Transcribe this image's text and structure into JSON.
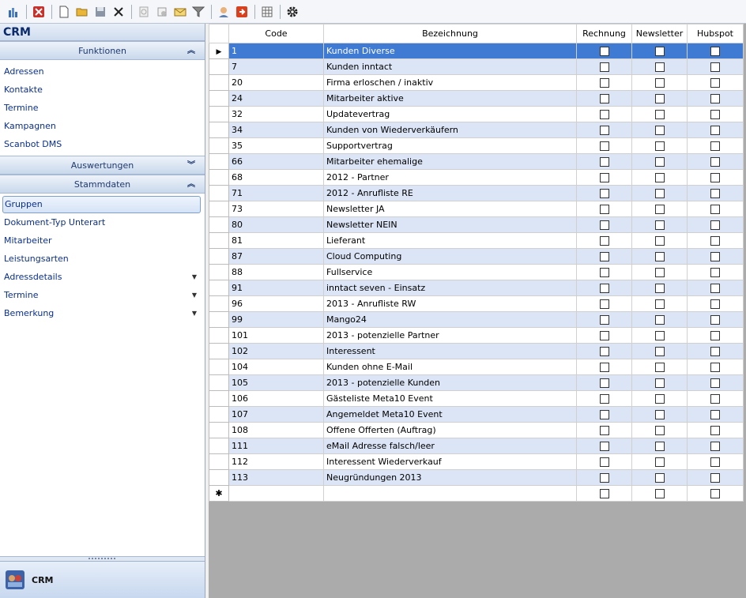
{
  "toolbar": {
    "icons": [
      "chart-icon",
      "delete-icon",
      "new-document-icon",
      "open-folder-icon",
      "save-icon",
      "close-icon",
      "copy-icon",
      "settings-doc-icon",
      "mail-icon",
      "filter-icon",
      "user-icon",
      "export-icon",
      "grid-icon",
      "gear-icon"
    ],
    "colors": {
      "delete": "#c8302c",
      "export": "#d9411e",
      "folder": "#e9b637"
    }
  },
  "sidebar": {
    "title": "CRM",
    "groups": [
      {
        "label": "Funktionen",
        "expanded": true,
        "items": [
          {
            "label": "Adressen"
          },
          {
            "label": "Kontakte"
          },
          {
            "label": "Termine"
          },
          {
            "label": "Kampagnen"
          },
          {
            "label": "Scanbot DMS"
          }
        ]
      },
      {
        "label": "Auswertungen",
        "expanded": false,
        "items": []
      },
      {
        "label": "Stammdaten",
        "expanded": true,
        "items": [
          {
            "label": "Gruppen",
            "selected": true
          },
          {
            "label": "Dokument-Typ Unterart"
          },
          {
            "label": "Mitarbeiter"
          },
          {
            "label": "Leistungsarten"
          },
          {
            "label": "Adressdetails",
            "dropdown": true
          },
          {
            "label": "Termine",
            "dropdown": true
          },
          {
            "label": "Bemerkung",
            "dropdown": true
          }
        ]
      }
    ],
    "module_label": "CRM"
  },
  "grid": {
    "columns": [
      "Code",
      "Bezeichnung",
      "Rechnung",
      "Newsletter",
      "Hubspot"
    ],
    "selected_row_color": "#3f7bd3",
    "alt_row_color": "#dbe5f6",
    "rows": [
      {
        "code": "1",
        "name": "Kunden Diverse"
      },
      {
        "code": "7",
        "name": "Kunden inntact"
      },
      {
        "code": "20",
        "name": "Firma erloschen / inaktiv"
      },
      {
        "code": "24",
        "name": "Mitarbeiter aktive"
      },
      {
        "code": "32",
        "name": "Updatevertrag"
      },
      {
        "code": "34",
        "name": "Kunden von Wiederverkäufern"
      },
      {
        "code": "35",
        "name": "Supportvertrag"
      },
      {
        "code": "66",
        "name": "Mitarbeiter ehemalige"
      },
      {
        "code": "68",
        "name": "2012 - Partner"
      },
      {
        "code": "71",
        "name": "2012 - Anrufliste RE"
      },
      {
        "code": "73",
        "name": "Newsletter JA"
      },
      {
        "code": "80",
        "name": "Newsletter NEIN"
      },
      {
        "code": "81",
        "name": "Lieferant"
      },
      {
        "code": "87",
        "name": "Cloud Computing"
      },
      {
        "code": "88",
        "name": "Fullservice"
      },
      {
        "code": "91",
        "name": "inntact seven - Einsatz"
      },
      {
        "code": "96",
        "name": "2013 - Anrufliste RW"
      },
      {
        "code": "99",
        "name": "Mango24"
      },
      {
        "code": "101",
        "name": "2013 - potenzielle Partner"
      },
      {
        "code": "102",
        "name": "Interessent"
      },
      {
        "code": "104",
        "name": "Kunden ohne E-Mail"
      },
      {
        "code": "105",
        "name": "2013 - potenzielle Kunden"
      },
      {
        "code": "106",
        "name": "Gästeliste Meta10 Event"
      },
      {
        "code": "107",
        "name": "Angemeldet Meta10 Event"
      },
      {
        "code": "108",
        "name": "Offene Offerten (Auftrag)"
      },
      {
        "code": "111",
        "name": "eMail Adresse falsch/leer"
      },
      {
        "code": "112",
        "name": "Interessent Wiederverkauf"
      },
      {
        "code": "113",
        "name": "Neugründungen 2013"
      }
    ],
    "current_row_marker": "▶",
    "new_row_marker": "✱"
  }
}
